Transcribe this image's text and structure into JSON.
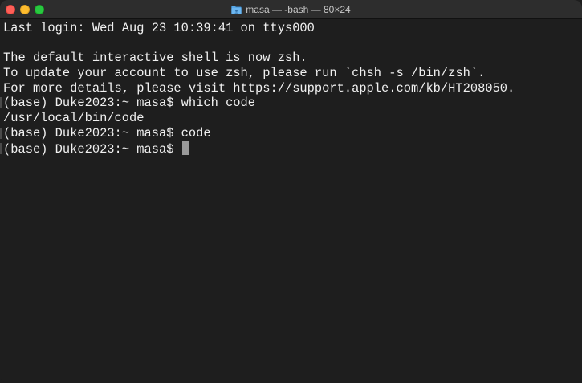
{
  "window": {
    "title": "masa — -bash — 80×24",
    "icon": "folder-icon"
  },
  "terminal": {
    "lines": [
      "Last login: Wed Aug 23 10:39:41 on ttys000",
      "",
      "The default interactive shell is now zsh.",
      "To update your account to use zsh, please run `chsh -s /bin/zsh`.",
      "For more details, please visit https://support.apple.com/kb/HT208050.",
      "(base) Duke2023:~ masa$ which code",
      "/usr/local/bin/code",
      "(base) Duke2023:~ masa$ code",
      "(base) Duke2023:~ masa$ "
    ]
  },
  "colors": {
    "background": "#1e1e1e",
    "text": "#f0f0f0",
    "cursor": "#9a9a9a"
  }
}
